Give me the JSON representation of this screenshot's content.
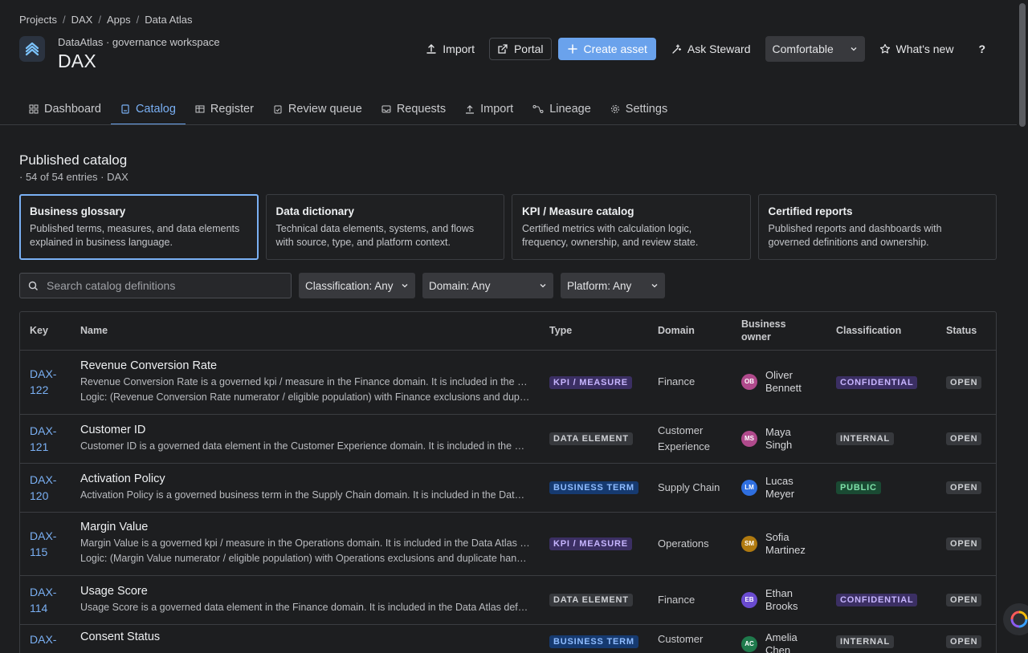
{
  "breadcrumb": [
    "Projects",
    "DAX",
    "Apps",
    "Data Atlas"
  ],
  "header": {
    "workspace": "DataAtlas · governance workspace",
    "title": "DAX"
  },
  "actions": {
    "import": "Import",
    "portal": "Portal",
    "create": "Create asset",
    "ask": "Ask Steward",
    "density": "Comfortable",
    "whats_new": "What's new",
    "help": "?"
  },
  "tabs": [
    {
      "label": "Dashboard",
      "icon": "dashboard-icon"
    },
    {
      "label": "Catalog",
      "icon": "catalog-icon"
    },
    {
      "label": "Register",
      "icon": "table-icon"
    },
    {
      "label": "Review queue",
      "icon": "clipboard-check-icon"
    },
    {
      "label": "Requests",
      "icon": "inbox-icon"
    },
    {
      "label": "Import",
      "icon": "upload-icon"
    },
    {
      "label": "Lineage",
      "icon": "lineage-icon"
    },
    {
      "label": "Settings",
      "icon": "gear-icon"
    }
  ],
  "catalog": {
    "title": "Published catalog",
    "subtitle": "· 54 of 54 entries · DAX"
  },
  "cards": [
    {
      "title": "Business glossary",
      "desc": "Published terms, measures, and data elements explained in business language."
    },
    {
      "title": "Data dictionary",
      "desc": "Technical data elements, systems, and flows with source, type, and platform context."
    },
    {
      "title": "KPI / Measure catalog",
      "desc": "Certified metrics with calculation logic, frequency, ownership, and review state."
    },
    {
      "title": "Certified reports",
      "desc": "Published reports and dashboards with governed definitions and ownership."
    }
  ],
  "filters": {
    "search_placeholder": "Search catalog definitions",
    "classification": "Classification: Any",
    "domain": "Domain: Any",
    "platform": "Platform: Any"
  },
  "table": {
    "columns": [
      "Key",
      "Name",
      "Type",
      "Domain",
      "Business owner",
      "Classification",
      "Status"
    ],
    "rows": [
      {
        "key_a": "DAX-",
        "key_b": "122",
        "name": "Revenue Conversion Rate",
        "desc": "Revenue Conversion Rate is a governed kpi / measure in the Finance domain. It is included in the Data Atlas definitions.",
        "logic": "Logic: (Revenue Conversion Rate numerator / eligible population) with Finance exclusions and duplicate handling.",
        "type": "KPI / MEASURE",
        "domain": "Finance",
        "owner_initials": "OB",
        "owner_a": "Oliver",
        "owner_b": "Bennett",
        "owner_color": "#b04a8c",
        "classification": "CONFIDENTIAL",
        "status": "OPEN"
      },
      {
        "key_a": "DAX-",
        "key_b": "121",
        "name": "Customer ID",
        "desc": "Customer ID is a governed data element in the Customer Experience domain. It is included in the Data Atlas definitions.",
        "logic": "",
        "type": "DATA ELEMENT",
        "domain": "Customer Experience",
        "owner_initials": "MS",
        "owner_a": "Maya",
        "owner_b": "Singh",
        "owner_color": "#b04a8c",
        "classification": "INTERNAL",
        "status": "OPEN"
      },
      {
        "key_a": "DAX-",
        "key_b": "120",
        "name": "Activation Policy",
        "desc": "Activation Policy is a governed business term in the Supply Chain domain. It is included in the Data Atlas definitions.",
        "logic": "",
        "type": "BUSINESS TERM",
        "domain": "Supply Chain",
        "owner_initials": "LM",
        "owner_a": "Lucas",
        "owner_b": "Meyer",
        "owner_color": "#2f6fe0",
        "classification": "PUBLIC",
        "status": "OPEN"
      },
      {
        "key_a": "DAX-",
        "key_b": "115",
        "name": "Margin Value",
        "desc": "Margin Value is a governed kpi / measure in the Operations domain. It is included in the Data Atlas definitions.",
        "logic": "Logic: (Margin Value numerator / eligible population) with Operations exclusions and duplicate handling.",
        "type": "KPI / MEASURE",
        "domain": "Operations",
        "owner_initials": "SM",
        "owner_a": "Sofia",
        "owner_b": "Martinez",
        "owner_color": "#b07a10",
        "classification": "",
        "status": "OPEN"
      },
      {
        "key_a": "DAX-",
        "key_b": "114",
        "name": "Usage Score",
        "desc": "Usage Score is a governed data element in the Finance domain. It is included in the Data Atlas definitions.",
        "logic": "",
        "type": "DATA ELEMENT",
        "domain": "Finance",
        "owner_initials": "EB",
        "owner_a": "Ethan",
        "owner_b": "Brooks",
        "owner_color": "#6a4bd0",
        "classification": "CONFIDENTIAL",
        "status": "OPEN"
      },
      {
        "key_a": "DAX-",
        "key_b": "",
        "name": "Consent Status",
        "desc": "",
        "logic": "",
        "type": "BUSINESS TERM",
        "domain": "Customer",
        "owner_initials": "AC",
        "owner_a": "Amelia",
        "owner_b": "Chen",
        "owner_color": "#1f7a4c",
        "classification": "INTERNAL",
        "status": "OPEN"
      }
    ]
  },
  "colors": {
    "accent": "#6aa2ec",
    "background": "#1d1e20"
  }
}
